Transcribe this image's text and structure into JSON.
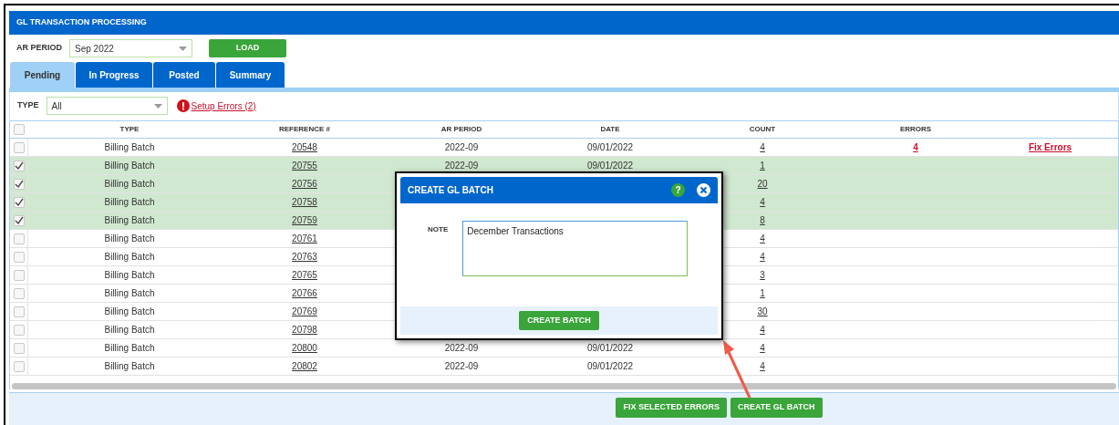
{
  "header": {
    "title": "GL TRANSACTION PROCESSING"
  },
  "period_filter": {
    "label": "AR PERIOD",
    "value": "Sep 2022",
    "button": "LOAD"
  },
  "tabs": [
    {
      "label": "Pending",
      "selected": true
    },
    {
      "label": "In Progress",
      "selected": false
    },
    {
      "label": "Posted",
      "selected": false
    },
    {
      "label": "Summary",
      "selected": false
    }
  ],
  "type_filter": {
    "label": "TYPE",
    "value": "All",
    "warning_link": "Setup Errors (2)"
  },
  "table": {
    "select_all": false,
    "columns": [
      "TYPE",
      "REFERENCE #",
      "AR PERIOD",
      "DATE",
      "COUNT",
      "ERRORS"
    ],
    "rows": [
      {
        "type": "Billing Batch",
        "reference": "20548",
        "ar_period": "2022-09",
        "date": "09/01/2022",
        "count": "4",
        "errors": "4",
        "action": "Fix Errors",
        "selected": false
      },
      {
        "type": "Billing Batch",
        "reference": "20755",
        "ar_period": "2022-09",
        "date": "09/01/2022",
        "count": "1",
        "selected": true
      },
      {
        "type": "Billing Batch",
        "reference": "20756",
        "count": "20",
        "selected": true
      },
      {
        "type": "Billing Batch",
        "reference": "20758",
        "count": "4",
        "selected": true
      },
      {
        "type": "Billing Batch",
        "reference": "20759",
        "count": "8",
        "selected": true
      },
      {
        "type": "Billing Batch",
        "reference": "20761",
        "count": "4",
        "selected": false
      },
      {
        "type": "Billing Batch",
        "reference": "20763",
        "count": "4",
        "selected": false
      },
      {
        "type": "Billing Batch",
        "reference": "20765",
        "count": "3",
        "selected": false
      },
      {
        "type": "Billing Batch",
        "reference": "20766",
        "count": "1",
        "selected": false
      },
      {
        "type": "Billing Batch",
        "reference": "20769",
        "count": "30",
        "selected": false
      },
      {
        "type": "Billing Batch",
        "reference": "20798",
        "count": "4",
        "selected": false
      },
      {
        "type": "Billing Batch",
        "reference": "20800",
        "ar_period": "2022-09",
        "date": "09/01/2022",
        "count": "4",
        "selected": false
      },
      {
        "type": "Billing Batch",
        "reference": "20802",
        "ar_period": "2022-09",
        "date": "09/01/2022",
        "count": "4",
        "selected": false
      }
    ]
  },
  "footer_buttons": [
    "FIX SELECTED ERRORS",
    "CREATE GL BATCH"
  ],
  "dialog": {
    "title": "CREATE GL BATCH",
    "help": "?",
    "note_label": "NOTE",
    "note_value": "December Transactions",
    "button": "CREATE BATCH"
  }
}
